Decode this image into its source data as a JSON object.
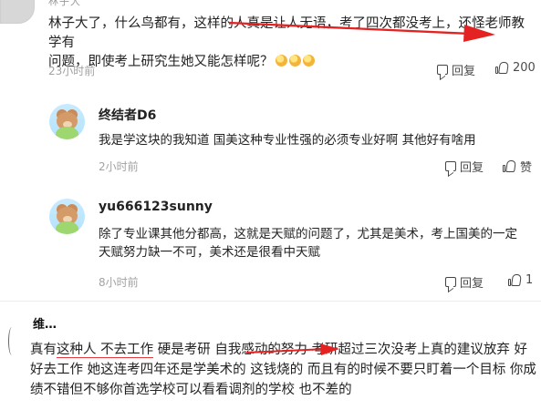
{
  "top_comment": {
    "avatar": "user-avatar",
    "author_partial": "林子大",
    "text_part1": "林子大了，什么鸟都有，",
    "text_highlight": "这样的人真是让人无语，考了四次都没考上，还怪老师教学有",
    "text_part2": "问题，即使考上研究生她又能怎样呢？",
    "emoji_count": 3,
    "time": "23小时前",
    "reply_label": "回复",
    "like_count": "200"
  },
  "replies": [
    {
      "author": "终结者D6",
      "avatar": "cartoon-bear-avatar",
      "text": "我是学这块的我知道 国美这种专业性强的必须专业好啊 其他好有啥用",
      "time": "2小时前",
      "reply_label": "回复",
      "like_label": "赞"
    },
    {
      "author": "yu666123sunny",
      "avatar": "cartoon-bear-avatar",
      "text_line1": "除了专业课其他分都高，这就是天赋的问题了，尤其是美术，考上国美的一定",
      "text_line2": "天赋努力缺一不可，美术还是很看中天赋",
      "time": "8小时前",
      "reply_label": "回复",
      "like_count": "1"
    }
  ],
  "bottom_comment": {
    "author": "维…",
    "text_line1_prefix": "真有",
    "text_line1_highlight": "这种人 不去工作",
    "text_line1_middle": " 硬是考研 自我感动的努力",
    "text_line1_suffix": " 考研超过三次没考上真的建议放弃 好",
    "text_line2": "好去工作 她这连考四年还是学美术的 这钱烧的 而且有的时候不要只盯着一个目标 你成",
    "text_line3": "绩不错但不够你首选学校可以看看调剂的学校 也不差的"
  },
  "annotation_color": "#e52222"
}
